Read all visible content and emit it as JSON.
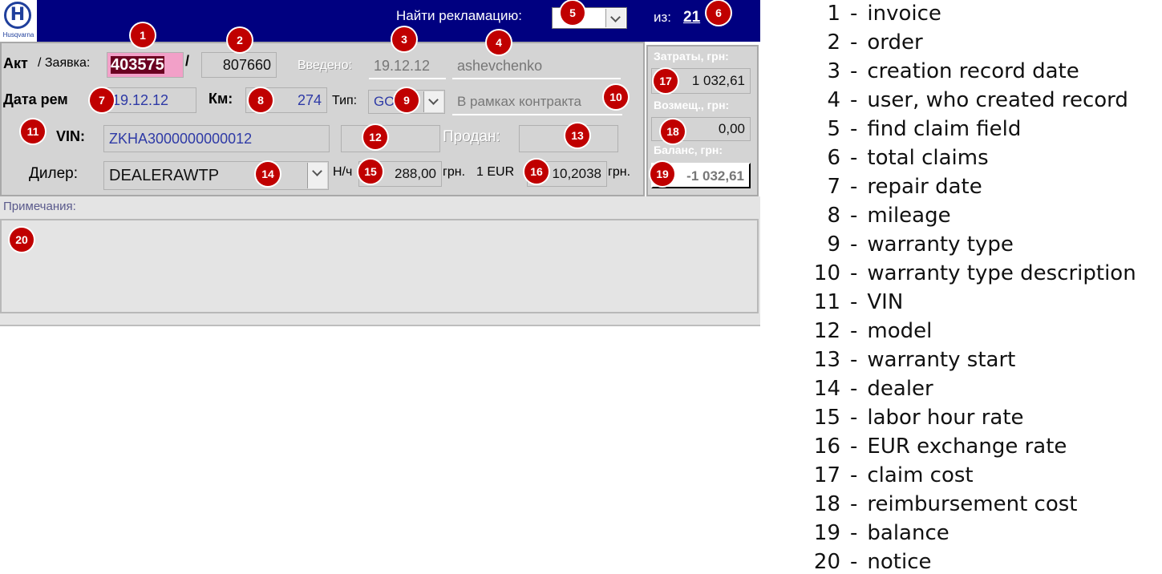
{
  "header": {
    "logo_letter": "H",
    "logo_text": "Husqvarna",
    "find_label": "Найти рекламацию:",
    "total_label": "из:",
    "total_value": "21"
  },
  "form": {
    "act_label": "Акт",
    "request_label": "/ Заявка:",
    "invoice": "403575",
    "slash": "/",
    "order": "807660",
    "entered_label": "Введено:",
    "created_date": "19.12.12",
    "created_user": "ashevchenko",
    "repair_label": "Дата рем",
    "repair_date": "19.12.12",
    "km_label": "Км:",
    "mileage": "274",
    "type_label": "Тип:",
    "warranty_type": "GO",
    "warranty_desc": "В рамках контракта",
    "vin_label": "VIN:",
    "vin": "ZKHA3000000000012",
    "model": "",
    "sold_label": "Продан:",
    "warranty_start": "",
    "dealer_label": "Дилер:",
    "dealer": "DEALERAWTP",
    "labor_label": "Н/ч",
    "labor_rate": "288,00",
    "labor_unit": "грн.",
    "eur_label": "1 EUR",
    "eur_rate": "10,2038",
    "eur_unit": "грн."
  },
  "side": {
    "cost_label": "Затраты, грн:",
    "cost": "1 032,61",
    "reimb_label": "Возмещ., грн:",
    "reimb": "0,00",
    "balance_label": "Баланс, грн:",
    "balance": "-1 032,61"
  },
  "notes": {
    "label": "Примечания:"
  },
  "markers": [
    "1",
    "2",
    "3",
    "4",
    "5",
    "6",
    "7",
    "8",
    "9",
    "10",
    "11",
    "12",
    "13",
    "14",
    "15",
    "16",
    "17",
    "18",
    "19",
    "20"
  ],
  "legend": [
    {
      "num": "1",
      "text": "invoice"
    },
    {
      "num": "2",
      "text": "order"
    },
    {
      "num": "3",
      "text": "creation record date"
    },
    {
      "num": "4",
      "text": "user, who created record"
    },
    {
      "num": "5",
      "text": "find claim field"
    },
    {
      "num": "6",
      "text": "total claims"
    },
    {
      "num": "7",
      "text": "repair date"
    },
    {
      "num": "8",
      "text": "mileage"
    },
    {
      "num": "9",
      "text": "warranty type"
    },
    {
      "num": "10",
      "text": "warranty type description"
    },
    {
      "num": "11",
      "text": "VIN"
    },
    {
      "num": "12",
      "text": "model"
    },
    {
      "num": "13",
      "text": "warranty start"
    },
    {
      "num": "14",
      "text": "dealer"
    },
    {
      "num": "15",
      "text": "labor hour rate"
    },
    {
      "num": "16",
      "text": "EUR exchange rate"
    },
    {
      "num": "17",
      "text": "claim cost"
    },
    {
      "num": "18",
      "text": "reimbursement cost"
    },
    {
      "num": "19",
      "text": "balance"
    },
    {
      "num": "20",
      "text": "notice"
    }
  ],
  "legend_separator": "-",
  "colors": {
    "header_bg": "#000080",
    "panel_bg": "#d4d4d4",
    "marker": "#c00000",
    "invoice_highlight": "#f2a0c8",
    "field_text_blue": "#2e3aa6"
  }
}
